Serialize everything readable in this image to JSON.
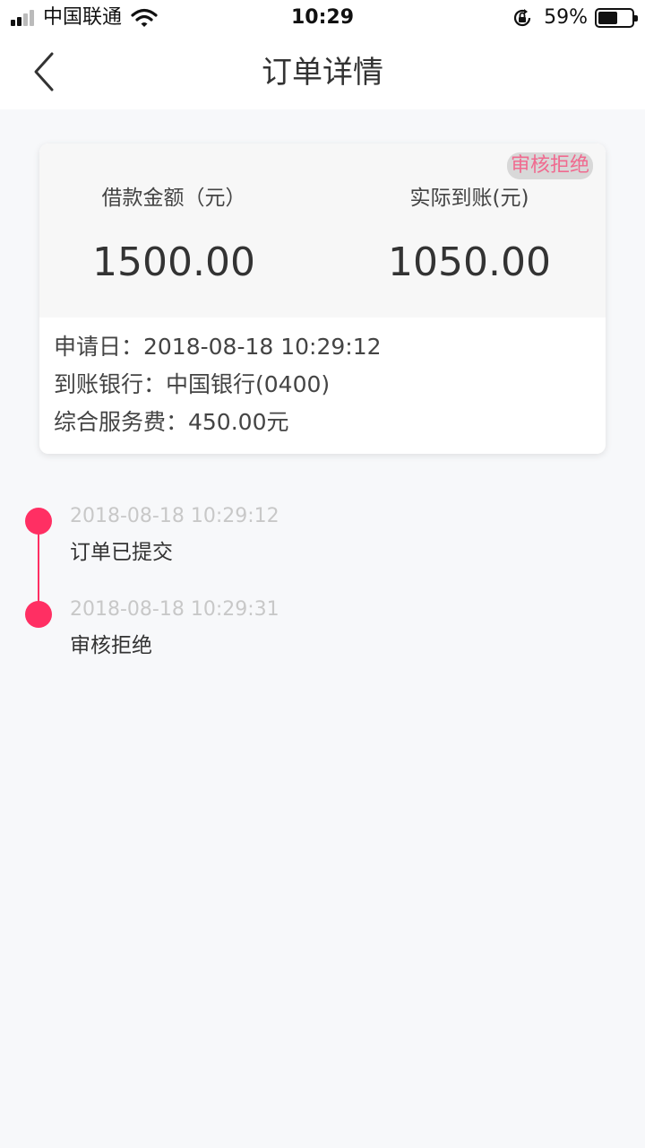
{
  "status_bar": {
    "carrier": "中国联通",
    "time": "10:29",
    "battery_percent": "59%",
    "battery_level": 0.59,
    "icons": [
      "signal-icon",
      "wifi-icon",
      "orientation-lock-icon",
      "battery-icon"
    ]
  },
  "nav": {
    "title": "订单详情",
    "back_icon": "chevron-left-icon"
  },
  "order": {
    "status": "审核拒绝",
    "loan_amount_label": "借款金额（元）",
    "loan_amount": "1500.00",
    "received_label": "实际到账(元)",
    "received_amount": "1050.00",
    "apply_date": "申请日：2018-08-18 10:29:12",
    "bank": "到账银行：中国银行(0400)",
    "service_fee": "综合服务费：450.00元"
  },
  "timeline": [
    {
      "time": "2018-08-18 10:29:12",
      "text": "订单已提交"
    },
    {
      "time": "2018-08-18 10:29:31",
      "text": "审核拒绝"
    }
  ],
  "colors": {
    "accent": "#ff2f63",
    "badge_text": "#f06a8f",
    "badge_bg": "#d8d8d8",
    "page_bg": "#f7f8fa"
  }
}
